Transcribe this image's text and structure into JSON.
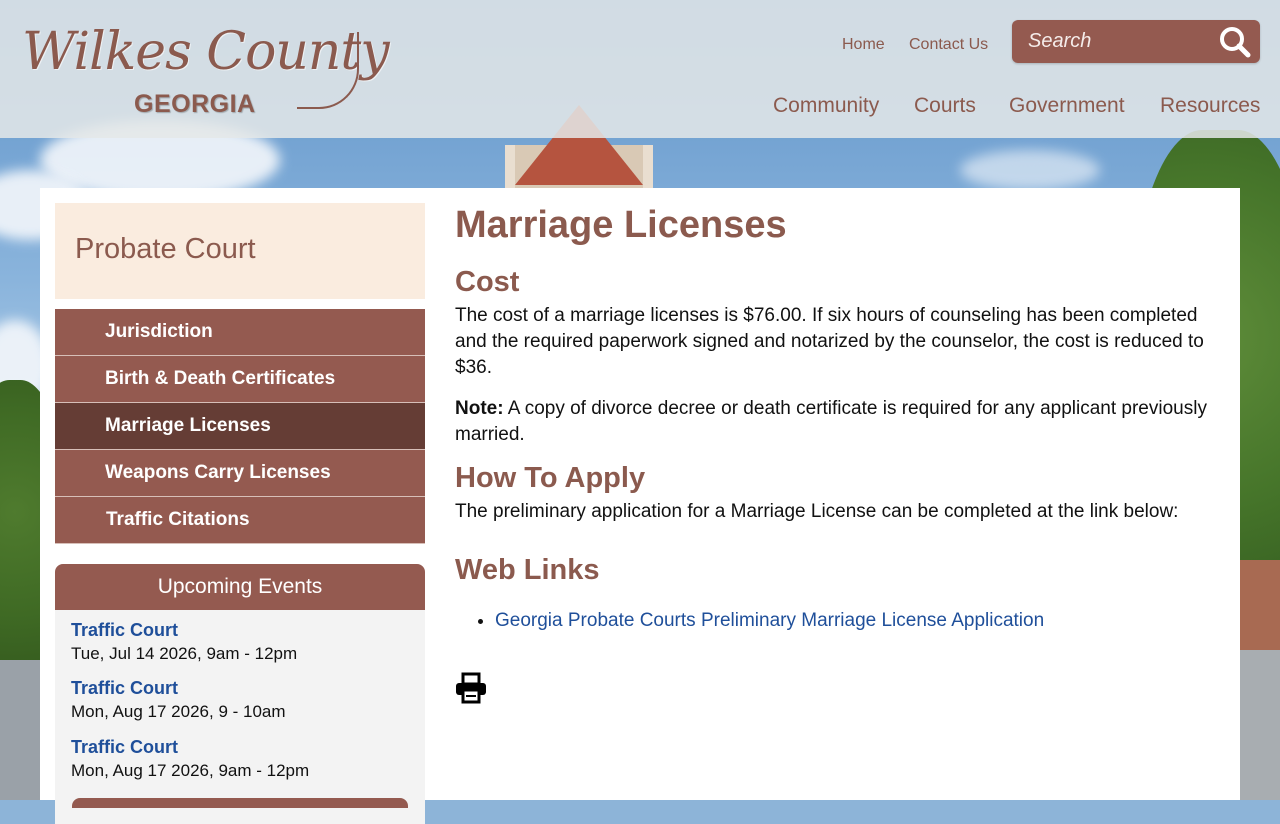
{
  "header": {
    "logo_script": "Wilkes County",
    "logo_sub": "GEORGIA",
    "util_links": [
      "Home",
      "Contact Us"
    ],
    "search_placeholder": "Search",
    "main_nav": [
      "Community",
      "Courts",
      "Government",
      "Resources"
    ]
  },
  "sidebar": {
    "title": "Probate Court",
    "items": [
      {
        "label": "Jurisdiction"
      },
      {
        "label": "Birth & Death Certificates"
      },
      {
        "label": "Marriage Licenses",
        "active": true
      },
      {
        "label": "Weapons Carry Licenses"
      },
      {
        "label": "Traffic Citations"
      }
    ]
  },
  "events": {
    "heading": "Upcoming Events",
    "list": [
      {
        "title": "Traffic Court",
        "date": "Tue, Jul 14 2026, 9am - 12pm"
      },
      {
        "title": "Traffic Court",
        "date": "Mon, Aug 17 2026, 9 - 10am"
      },
      {
        "title": "Traffic Court",
        "date": "Mon, Aug 17 2026, 9am - 12pm"
      }
    ]
  },
  "main": {
    "title": "Marriage Licenses",
    "cost_heading": "Cost",
    "cost_text": "The cost of a marriage licenses is $76.00. If six hours of counseling has been completed and the required paperwork signed and notarized by the counselor, the cost is reduced to $36.",
    "note_label": "Note:",
    "note_text": " A copy of divorce decree or death certificate is required for any applicant previously married.",
    "apply_heading": "How To Apply",
    "apply_text": "The preliminary application for a Marriage License can be completed at the link below:",
    "links_heading": "Web Links",
    "links": [
      "Georgia Probate Courts Preliminary Marriage License Application"
    ]
  },
  "colors": {
    "brand": "#945a50",
    "brand_dark": "#653d35",
    "title_text": "#8b5a4e",
    "link": "#1f4f9a",
    "sidebar_title_bg": "#faecdf"
  },
  "icons": {
    "search": "search-icon",
    "print": "printer-icon"
  }
}
